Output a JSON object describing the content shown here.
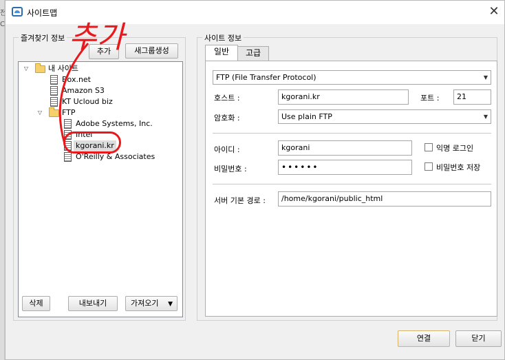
{
  "background": {
    "edge_char_1": "전",
    "edge_char_2": "C"
  },
  "window": {
    "title": "사이트맵",
    "close_label": "✕"
  },
  "left_panel": {
    "legend": "즐겨찾기 정보",
    "add_label": "추가",
    "new_group_label": "새그룹생성",
    "delete_label": "삭제",
    "export_label": "내보내기",
    "import_label": "가져오기",
    "import_caret": "▼",
    "tree": {
      "root_label": "내 사이트",
      "items": [
        "Box.net",
        "Amazon S3",
        "KT Ucloud biz"
      ],
      "ftp_folder_label": "FTP",
      "ftp_items": [
        "Adobe Systems, Inc.",
        "Intel",
        "kgorani.kr",
        "O'Reilly & Associates"
      ]
    }
  },
  "annotation": {
    "handwritten_text": "추가"
  },
  "right_panel": {
    "legend": "사이트 정보",
    "tabs": [
      "일반",
      "고급"
    ],
    "protocol": "FTP (File Transfer Protocol)",
    "host_label": "호스트 :",
    "host_value": "kgorani.kr",
    "port_label": "포트 :",
    "port_value": "21",
    "encryption_label": "암호화 :",
    "encryption_value": "Use plain FTP",
    "id_label": "아이디 :",
    "id_value": "kgorani",
    "anonymous_label": "익명 로그인",
    "password_label": "비밀번호 :",
    "password_value": "••••••",
    "save_password_label": "비밀번호 저장",
    "path_label": "서버 기본 경로 :",
    "path_value": "/home/kgorani/public_html"
  },
  "footer": {
    "connect_label": "연결",
    "close_label": "닫기"
  },
  "colors": {
    "annotation_red": "#e8191c",
    "connect_border": "#d8b46a"
  }
}
